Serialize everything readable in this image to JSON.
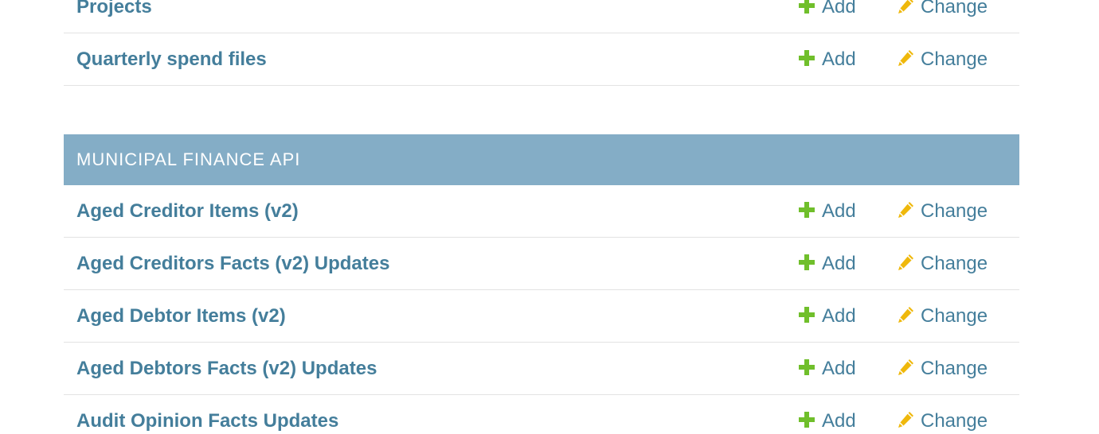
{
  "modules": [
    {
      "caption": "",
      "rows": [
        {
          "name": "Projects",
          "add_label": "Add",
          "change_label": "Change"
        },
        {
          "name": "Quarterly spend files",
          "add_label": "Add",
          "change_label": "Change"
        }
      ]
    },
    {
      "caption": "MUNICIPAL FINANCE API",
      "rows": [
        {
          "name": "Aged Creditor Items (v2)",
          "add_label": "Add",
          "change_label": "Change"
        },
        {
          "name": "Aged Creditors Facts (v2) Updates",
          "add_label": "Add",
          "change_label": "Change"
        },
        {
          "name": "Aged Debtor Items (v2)",
          "add_label": "Add",
          "change_label": "Change"
        },
        {
          "name": "Aged Debtors Facts (v2) Updates",
          "add_label": "Add",
          "change_label": "Change"
        },
        {
          "name": "Audit Opinion Facts Updates",
          "add_label": "Add",
          "change_label": "Change"
        }
      ]
    }
  ],
  "icons": {
    "add": "plus-icon",
    "change": "pencil-icon"
  },
  "colors": {
    "caption_bg": "#84adc6",
    "link": "#447e9b",
    "add_icon": "#70bf2b",
    "change_icon": "#efb80b",
    "divider": "#e3e3e3"
  }
}
